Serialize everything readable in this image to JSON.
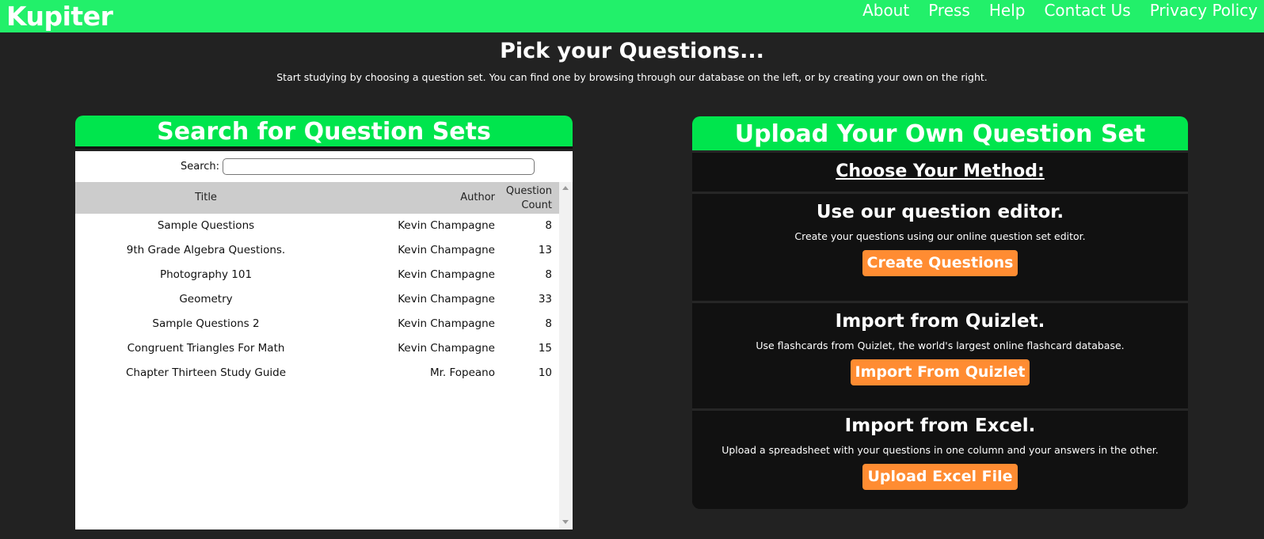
{
  "app": {
    "brand": "Kupiter",
    "nav": [
      "About",
      "Press",
      "Help",
      "Contact Us",
      "Privacy Policy"
    ]
  },
  "page": {
    "heading": "Pick your Questions...",
    "subheading": "Start studying by choosing a question set. You can find one by browsing through our database on the left, or by creating your own on the right."
  },
  "search_panel": {
    "title": "Search for Question Sets",
    "search_label": "Search:",
    "search_value": "",
    "columns": {
      "title": "Title",
      "author": "Author",
      "count_line1": "Question",
      "count_line2": "Count"
    },
    "rows": [
      {
        "title": "Sample Questions",
        "author": "Kevin Champagne",
        "count": "8"
      },
      {
        "title": "9th Grade Algebra Questions.",
        "author": "Kevin Champagne",
        "count": "13"
      },
      {
        "title": "Photography 101",
        "author": "Kevin Champagne",
        "count": "8"
      },
      {
        "title": "Geometry",
        "author": "Kevin Champagne",
        "count": "33"
      },
      {
        "title": "Sample Questions 2",
        "author": "Kevin Champagne",
        "count": "8"
      },
      {
        "title": "Congruent Triangles For Math",
        "author": "Kevin Champagne",
        "count": "15"
      },
      {
        "title": "Chapter Thirteen Study Guide",
        "author": "Mr. Fopeano",
        "count": "10"
      }
    ]
  },
  "upload_panel": {
    "title": "Upload Your Own Question Set",
    "method_title": "Choose Your Method:",
    "editor": {
      "title": "Use our question editor.",
      "desc": "Create your questions using our online question set editor.",
      "button": "Create Questions"
    },
    "quizlet": {
      "title": "Import from Quizlet.",
      "desc": "Use flashcards from Quizlet, the world's largest online flashcard database.",
      "button": "Import From Quizlet"
    },
    "excel": {
      "title": "Import from Excel.",
      "desc": "Upload a spreadsheet with your questions in one column and your answers in the other.",
      "button": "Upload Excel File"
    }
  },
  "colors": {
    "topbar": "#22f06a",
    "panel_header": "#00e54d",
    "button": "#ff8c32",
    "background": "#222222"
  }
}
